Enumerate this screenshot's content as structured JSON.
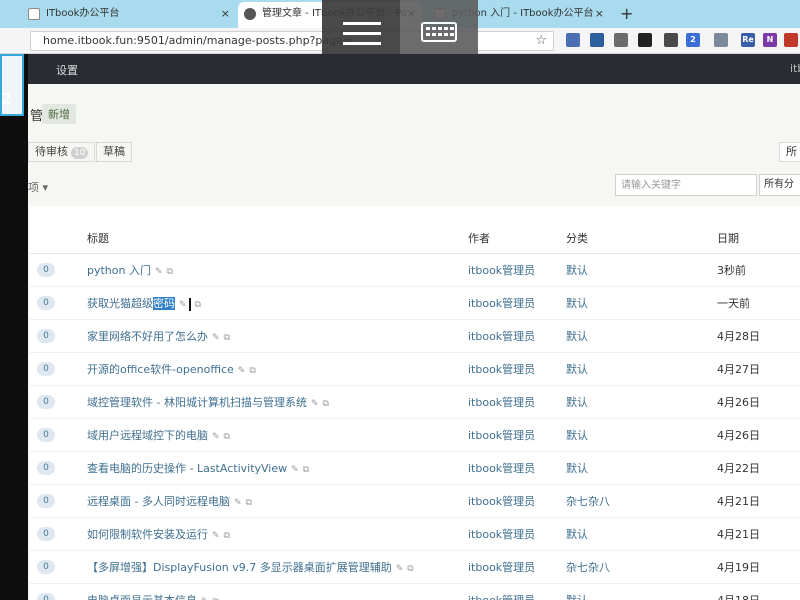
{
  "browser": {
    "tabs": [
      {
        "title": "ITbook办公平台",
        "close": "×"
      },
      {
        "title": "管理文章 - ITbook办公平台 - Po",
        "close": "×"
      },
      {
        "title": "python 入门 - ITbook办公平台",
        "close": "×"
      }
    ],
    "new_tab": "+",
    "url": "home.itbook.fun:9501/admin/manage-posts.php?page=",
    "star": "☆",
    "extensions": [
      {
        "icon": "shield-icon",
        "color": "#4a6fb5",
        "label": ""
      },
      {
        "icon": "bookmark-icon",
        "color": "#2b5f9e",
        "label": ""
      },
      {
        "icon": "puzzle-icon",
        "color": "#6c6c6c",
        "label": ""
      },
      {
        "icon": "camera-icon",
        "color": "#222222",
        "label": ""
      },
      {
        "icon": "gear-icon",
        "color": "#4a4a4a",
        "label": ""
      },
      {
        "icon": "badge-icon",
        "color": "#3b6fd6",
        "label": "2"
      },
      {
        "icon": "lock-icon",
        "color": "#7a8a9a",
        "label": ""
      },
      {
        "icon": "re-icon",
        "color": "#3a5ea8",
        "label": "Re"
      },
      {
        "icon": "onenote-icon",
        "color": "#7b3aa8",
        "label": "N"
      },
      {
        "icon": "grid-icon",
        "color": "#c0392b",
        "label": ""
      },
      {
        "icon": "box-icon",
        "color": "#333333",
        "label": ""
      }
    ]
  },
  "overlay": {
    "menu_icon": "hamburger-icon",
    "keyboard_icon": "keyboard-icon"
  },
  "left": {
    "digit": "2"
  },
  "admin": {
    "nav_item": "设置",
    "nav_right": "itb",
    "page_title": "管",
    "add_label": "新增"
  },
  "filters": {
    "all_partial": "所",
    "pending": "待审核",
    "pending_count": "10",
    "draft": "草稿",
    "right_partial": "所"
  },
  "tools": {
    "select_op": "选中项",
    "search_placeholder": "请输入关键字",
    "category": "所有分"
  },
  "table": {
    "headers": {
      "title": "标题",
      "author": "作者",
      "category": "分类",
      "date": "日期"
    },
    "rows": [
      {
        "comments": "0",
        "title": "python 入门",
        "author": "itbook管理员",
        "category": "默认",
        "date": "3秒前"
      },
      {
        "comments": "0",
        "title_pre": "获取光猫超级",
        "title_sel": "密码",
        "author": "itbook管理员",
        "category": "默认",
        "date": "一天前"
      },
      {
        "comments": "0",
        "title": "家里网络不好用了怎么办",
        "author": "itbook管理员",
        "category": "默认",
        "date": "4月28日"
      },
      {
        "comments": "0",
        "title": "开源的office软件-openoffice",
        "author": "itbook管理员",
        "category": "默认",
        "date": "4月27日"
      },
      {
        "comments": "0",
        "title": "域控管理软件 - 林阳城计算机扫描与管理系统",
        "author": "itbook管理员",
        "category": "默认",
        "date": "4月26日"
      },
      {
        "comments": "0",
        "title": "域用户远程域控下的电脑",
        "author": "itbook管理员",
        "category": "默认",
        "date": "4月26日"
      },
      {
        "comments": "0",
        "title": "查看电脑的历史操作 - LastActivityView",
        "author": "itbook管理员",
        "category": "默认",
        "date": "4月22日"
      },
      {
        "comments": "0",
        "title": "远程桌面 - 多人同时远程电脑",
        "author": "itbook管理员",
        "category": "杂七杂八",
        "date": "4月21日"
      },
      {
        "comments": "0",
        "title": "如何限制软件安装及运行",
        "author": "itbook管理员",
        "category": "默认",
        "date": "4月21日"
      },
      {
        "comments": "0",
        "title": "【多屏增强】DisplayFusion v9.7 多显示器桌面扩展管理辅助",
        "author": "itbook管理员",
        "category": "杂七杂八",
        "date": "4月19日"
      },
      {
        "comments": "0",
        "title": "电脑桌面显示基本信息",
        "author": "itbook管理员",
        "category": "默认",
        "date": "4月18日"
      }
    ]
  }
}
